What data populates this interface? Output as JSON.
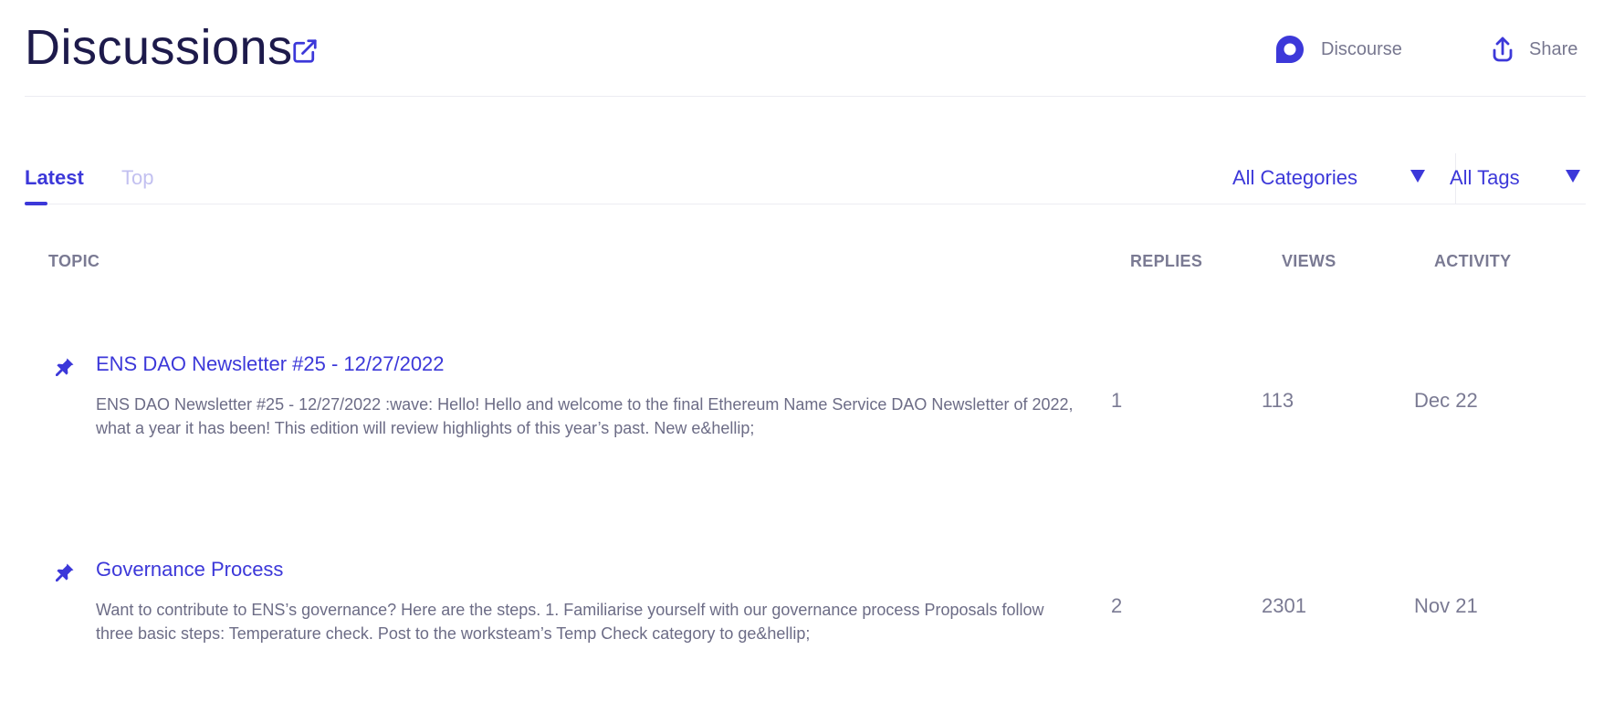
{
  "header": {
    "title": "Discussions",
    "discourse_label": "Discourse",
    "share_label": "Share"
  },
  "tabs": [
    {
      "label": "Latest",
      "active": true
    },
    {
      "label": "Top",
      "active": false
    }
  ],
  "filters": {
    "categories": "All Categories",
    "tags": "All Tags"
  },
  "columns": {
    "topic": "TOPIC",
    "replies": "REPLIES",
    "views": "VIEWS",
    "activity": "ACTIVITY"
  },
  "topics": [
    {
      "title": "ENS DAO Newsletter #25 - 12/27/2022",
      "excerpt": "ENS DAO Newsletter #25 - 12/27/2022 :wave: Hello! Hello and welcome to the final Ethereum Name Service DAO Newsletter of 2022, what a year it has been! This edition will review highlights of this year’s past. New e&hellip;",
      "replies": "1",
      "views": "113",
      "activity": "Dec 22",
      "icon": "pin-icon"
    },
    {
      "title": "Governance Process",
      "excerpt": "Want to contribute to ENS’s governance? Here are the steps. 1. Familiarise yourself with our governance process Proposals follow three basic steps: Temperature check. Post to the worksteam’s Temp Check category to ge&hellip;",
      "replies": "2",
      "views": "2301",
      "activity": "Nov 21",
      "icon": "pin-icon"
    }
  ],
  "colors": {
    "accent": "#3c38d9",
    "title": "#1d1a4b",
    "muted": "#7a7a93"
  }
}
